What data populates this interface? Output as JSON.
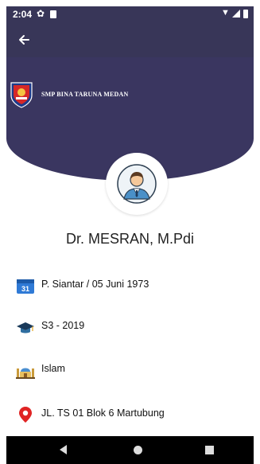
{
  "status_bar": {
    "time": "2:04",
    "icons": [
      "gear-icon",
      "sd-card-icon",
      "wifi-icon",
      "signal-icon",
      "battery-icon"
    ]
  },
  "app_bar": {
    "back_icon": "arrow-left-icon"
  },
  "header": {
    "school_name": "SMP BINA TARUNA MEDAN",
    "logo": "school-logo"
  },
  "profile": {
    "name": "Dr. MESRAN, M.Pdi",
    "avatar_icon": "teacher-avatar-icon"
  },
  "info": [
    {
      "icon": "calendar-icon",
      "text": "P. Siantar / 05 Juni 1973"
    },
    {
      "icon": "graduation-cap-icon",
      "text": "S3 - 2019"
    },
    {
      "icon": "mosque-icon",
      "text": "Islam"
    },
    {
      "icon": "location-pin-icon",
      "text": "JL. TS 01 Blok 6 Martubung"
    }
  ],
  "nav_bar": {
    "icons": [
      "nav-back-icon",
      "nav-home-icon",
      "nav-recents-icon"
    ]
  },
  "colors": {
    "header": "#3a3660",
    "status_bar": "#383658",
    "nav_bar": "#000000"
  }
}
